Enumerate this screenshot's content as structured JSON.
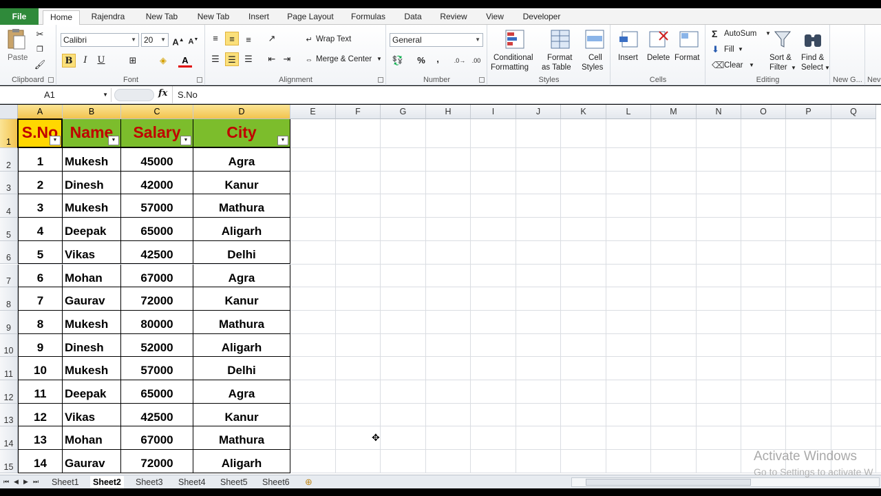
{
  "tabs": {
    "file": "File",
    "items": [
      "Home",
      "Rajendra",
      "New Tab",
      "New Tab",
      "Insert",
      "Page Layout",
      "Formulas",
      "Data",
      "Review",
      "View",
      "Developer"
    ]
  },
  "ribbon": {
    "clipboard": {
      "label": "Clipboard",
      "paste": "Paste"
    },
    "font": {
      "label": "Font",
      "name": "Calibri",
      "size": "20",
      "bold": "B",
      "italic": "I",
      "underline": "U"
    },
    "alignment": {
      "label": "Alignment",
      "wrap": "Wrap Text",
      "merge": "Merge & Center"
    },
    "number": {
      "label": "Number",
      "format": "General",
      "percent": "%",
      "comma": ","
    },
    "styles": {
      "label": "Styles",
      "conditional_1": "Conditional",
      "conditional_2": "Formatting",
      "format_1": "Format",
      "format_2": "as Table",
      "cell_1": "Cell",
      "cell_2": "Styles"
    },
    "cells": {
      "label": "Cells",
      "insert": "Insert",
      "delete": "Delete",
      "format": "Format"
    },
    "editing": {
      "label": "Editing",
      "autosum": "AutoSum",
      "fill": "Fill",
      "clear": "Clear",
      "sort_1": "Sort &",
      "sort_2": "Filter",
      "find_1": "Find &",
      "find_2": "Select"
    },
    "newgroup": {
      "label": "New G..."
    },
    "extra": {
      "label": "Nev"
    }
  },
  "formula_bar": {
    "name_box": "A1",
    "fx": "fx",
    "value": "S.No"
  },
  "columns": [
    "A",
    "B",
    "C",
    "D",
    "E",
    "F",
    "G",
    "H",
    "I",
    "J",
    "K",
    "L",
    "M",
    "N",
    "O",
    "P",
    "Q"
  ],
  "rows": [
    "1",
    "2",
    "3",
    "4",
    "5",
    "6",
    "7",
    "8",
    "9",
    "10",
    "11",
    "12",
    "13",
    "14",
    "15"
  ],
  "table": {
    "headers": [
      "S.No",
      "Name",
      "Salary",
      "City"
    ],
    "rows": [
      [
        "1",
        "Mukesh",
        "45000",
        "Agra"
      ],
      [
        "2",
        "Dinesh",
        "42000",
        "Kanur"
      ],
      [
        "3",
        "Mukesh",
        "57000",
        "Mathura"
      ],
      [
        "4",
        "Deepak",
        "65000",
        "Aligarh"
      ],
      [
        "5",
        "Vikas",
        "42500",
        "Delhi"
      ],
      [
        "6",
        "Mohan",
        "67000",
        "Agra"
      ],
      [
        "7",
        "Gaurav",
        "72000",
        "Kanur"
      ],
      [
        "8",
        "Mukesh",
        "80000",
        "Mathura"
      ],
      [
        "9",
        "Dinesh",
        "52000",
        "Aligarh"
      ],
      [
        "10",
        "Mukesh",
        "57000",
        "Delhi"
      ],
      [
        "11",
        "Deepak",
        "65000",
        "Agra"
      ],
      [
        "12",
        "Vikas",
        "42500",
        "Kanur"
      ],
      [
        "13",
        "Mohan",
        "67000",
        "Mathura"
      ],
      [
        "14",
        "Gaurav",
        "72000",
        "Aligarh"
      ]
    ]
  },
  "sheets": [
    "Sheet1",
    "Sheet2",
    "Sheet3",
    "Sheet4",
    "Sheet5",
    "Sheet6"
  ],
  "active_sheet": "Sheet2",
  "watermark": {
    "line1": "Activate Windows",
    "line2": "Go to Settings to activate W"
  },
  "colors": {
    "header_yellow": "#ffd700",
    "header_green": "#7cbd2c",
    "header_text": "#c00000",
    "file_tab": "#2f8a3a"
  }
}
